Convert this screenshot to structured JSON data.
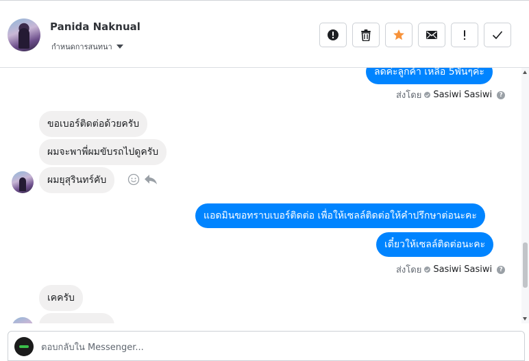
{
  "header": {
    "contact_name": "Panida Naknual",
    "assign_label": "กำหนดการสนทนา",
    "actions": [
      {
        "name": "spam-button",
        "icon": "exclamation-circle-icon"
      },
      {
        "name": "delete-button",
        "icon": "trash-icon"
      },
      {
        "name": "star-button",
        "icon": "star-icon",
        "color": "#f7923a"
      },
      {
        "name": "mark-unread-button",
        "icon": "envelope-icon"
      },
      {
        "name": "follow-up-button",
        "icon": "exclamation-icon"
      },
      {
        "name": "done-button",
        "icon": "checkmark-icon"
      }
    ]
  },
  "thread": {
    "messages": [
      {
        "side": "out",
        "text": "ลดค่ะลูกค้า เหลือ 5พันๆค่ะ"
      },
      {
        "side": "out",
        "sent_by_prefix": "ส่งโดย",
        "sent_by_name": "Sasiwi Sasiwi"
      },
      {
        "side": "in",
        "text": "ขอเบอร์ติดต่อด้วยครับ"
      },
      {
        "side": "in",
        "text": "ผมจะพาพี่ผมขับรถไปดูครับ"
      },
      {
        "side": "in",
        "text": "ผมยุสุรินทร์คับ"
      },
      {
        "side": "out",
        "text": "แอดมินขอทราบเบอร์ติดต่อ เพื่อให้เซลล์ติดต่อให้คำปรึกษาต่อนะคะ"
      },
      {
        "side": "out",
        "text": "เดี๋ยวให้เซลล์ติดต่อนะคะ"
      },
      {
        "side": "out",
        "sent_by_prefix": "ส่งโดย",
        "sent_by_name": "Sasiwi Sasiwi"
      },
      {
        "side": "in",
        "text": "เคครับ"
      }
    ]
  },
  "composer": {
    "placeholder": "ตอบกลับใน Messenger..."
  },
  "colors": {
    "outgoing_bubble": "#0084ff",
    "incoming_bubble": "#f1f0f0",
    "star": "#f7923a"
  }
}
